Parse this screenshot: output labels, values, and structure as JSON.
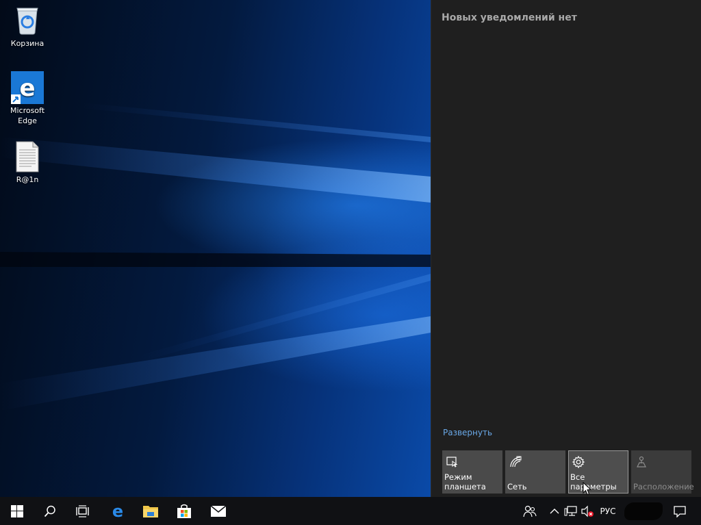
{
  "desktop": {
    "icons": [
      {
        "label": "Корзина"
      },
      {
        "label": "Microsoft Edge"
      },
      {
        "label": "R@1n"
      }
    ]
  },
  "action_center": {
    "title": "Новых уведомлений нет",
    "expand_link": "Развернуть",
    "tiles": [
      {
        "label": "Режим планшета",
        "icon": "tablet-mode-icon"
      },
      {
        "label": "Сеть",
        "icon": "network-icon"
      },
      {
        "label": "Все параметры",
        "icon": "gear-icon"
      },
      {
        "label": "Расположение",
        "icon": "location-icon"
      }
    ]
  },
  "taskbar": {
    "pinned": [
      "start",
      "search",
      "task-view",
      "edge",
      "file-explorer",
      "store",
      "mail"
    ],
    "language": "РУС"
  },
  "colors": {
    "action_center_bg": "#1f1f1f",
    "tile_bg": "#4a4a4a",
    "link": "#6aa9e8",
    "taskbar_bg": "#101114",
    "accent_blue": "#0078d7"
  }
}
